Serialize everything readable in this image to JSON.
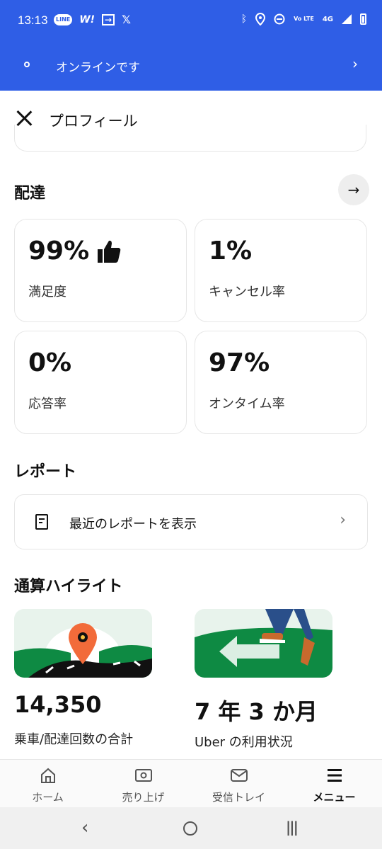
{
  "status_bar": {
    "time": "13:13",
    "left_icons": [
      "line-icon",
      "w1-icon",
      "arrow-box-icon",
      "x-icon"
    ],
    "right_icons": [
      "bluetooth-icon",
      "location-icon",
      "do-not-disturb-icon",
      "volte-icon",
      "4g-icon",
      "signal-icon",
      "battery-icon"
    ],
    "volte_text": "Vo LTE",
    "network": "4G"
  },
  "online_banner": {
    "text": "オンラインです",
    "color": "#2f5ee6"
  },
  "header": {
    "title": "プロフィール"
  },
  "delivery": {
    "title": "配達",
    "stats": [
      {
        "value": "99%",
        "label": "満足度"
      },
      {
        "value": "1%",
        "label": "キャンセル率"
      },
      {
        "value": "0%",
        "label": "応答率"
      },
      {
        "value": "97%",
        "label": "オンタイム率"
      }
    ]
  },
  "report": {
    "title": "レポート",
    "link_label": "最近のレポートを表示"
  },
  "highlights": {
    "title": "通算ハイライト",
    "items": [
      {
        "value": "14,350",
        "label": "乗車/配達回数の合計"
      },
      {
        "value": "7 年 3 か月",
        "label": "Uber の利用状況"
      }
    ]
  },
  "bottom_nav": {
    "items": [
      {
        "label": "ホーム",
        "icon": "home-icon",
        "active": false
      },
      {
        "label": "売り上げ",
        "icon": "earnings-icon",
        "active": false
      },
      {
        "label": "受信トレイ",
        "icon": "inbox-icon",
        "active": false
      },
      {
        "label": "メニュー",
        "icon": "menu-icon",
        "active": true
      }
    ]
  },
  "colors": {
    "accent": "#2f5ee6",
    "map_green": "#0e8a43",
    "pin_orange": "#f26b3a"
  }
}
